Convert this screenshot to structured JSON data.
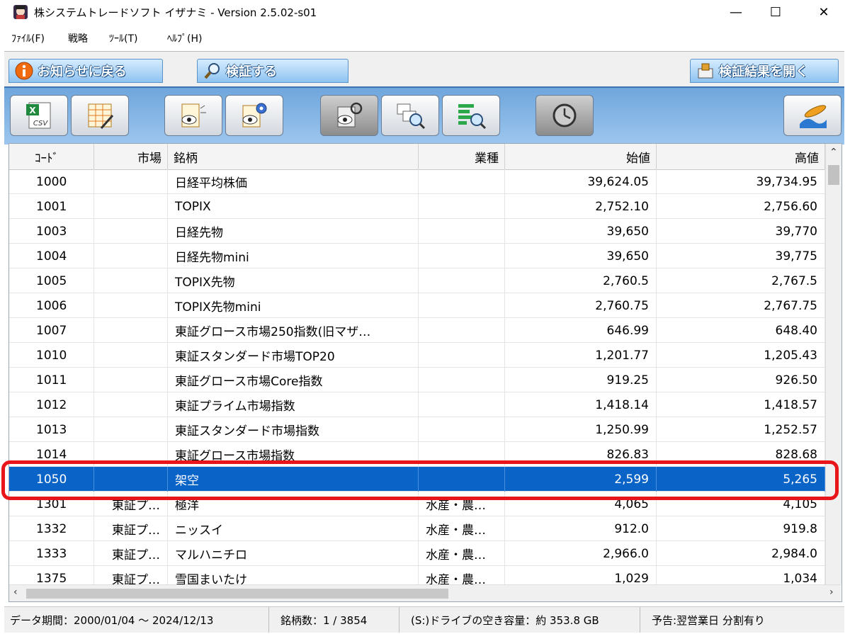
{
  "window": {
    "title": "株システムトレードソフト イザナミ - Version 2.5.02-s01",
    "minimize": "—",
    "maximize": "☐",
    "close": "✕"
  },
  "menu": [
    "ﾌｧｲﾙ(F)",
    "戦略",
    "ﾂｰﾙ(T)",
    "ﾍﾙﾌﾟ(H)"
  ],
  "tabs": {
    "back": "お知らせに戻る",
    "verify": "検証する",
    "open_results": "検証結果を開く"
  },
  "toolbar_icons": [
    "csv-export-icon",
    "table-edit-icon",
    "watch-list-icon",
    "watch-settings-icon",
    "reload-watch-icon",
    "chart-search-icon",
    "ranking-search-icon",
    "timer-icon",
    "surf-icon"
  ],
  "table": {
    "columns": [
      "ｺｰﾄﾞ",
      "市場",
      "銘柄",
      "業種",
      "始値",
      "高値"
    ],
    "rows": [
      {
        "code": "1000",
        "market": "",
        "name": "日経平均株価",
        "industry": "",
        "open": "39,624.05",
        "high": "39,734.95"
      },
      {
        "code": "1001",
        "market": "",
        "name": "TOPIX",
        "industry": "",
        "open": "2,752.10",
        "high": "2,756.60"
      },
      {
        "code": "1003",
        "market": "",
        "name": "日経先物",
        "industry": "",
        "open": "39,650",
        "high": "39,770"
      },
      {
        "code": "1004",
        "market": "",
        "name": "日経先物mini",
        "industry": "",
        "open": "39,650",
        "high": "39,775"
      },
      {
        "code": "1005",
        "market": "",
        "name": "TOPIX先物",
        "industry": "",
        "open": "2,760.5",
        "high": "2,767.5"
      },
      {
        "code": "1006",
        "market": "",
        "name": "TOPIX先物mini",
        "industry": "",
        "open": "2,760.75",
        "high": "2,767.75"
      },
      {
        "code": "1007",
        "market": "",
        "name": "東証グロース市場250指数(旧マザ…",
        "industry": "",
        "open": "646.99",
        "high": "648.40"
      },
      {
        "code": "1010",
        "market": "",
        "name": "東証スタンダード市場TOP20",
        "industry": "",
        "open": "1,201.77",
        "high": "1,205.43"
      },
      {
        "code": "1011",
        "market": "",
        "name": "東証グロース市場Core指数",
        "industry": "",
        "open": "919.25",
        "high": "926.50"
      },
      {
        "code": "1012",
        "market": "",
        "name": "東証プライム市場指数",
        "industry": "",
        "open": "1,418.14",
        "high": "1,418.57"
      },
      {
        "code": "1013",
        "market": "",
        "name": "東証スタンダード市場指数",
        "industry": "",
        "open": "1,250.99",
        "high": "1,252.57"
      },
      {
        "code": "1014",
        "market": "",
        "name": "東証グロース市場指数",
        "industry": "",
        "open": "826.83",
        "high": "828.68"
      },
      {
        "code": "1050",
        "market": "",
        "name": "架空",
        "industry": "",
        "open": "2,599",
        "high": "5,265",
        "selected": true
      },
      {
        "code": "1301",
        "market": "東証プ…",
        "name": "極洋",
        "industry": "水産・農…",
        "open": "4,065",
        "high": "4,105"
      },
      {
        "code": "1332",
        "market": "東証プ…",
        "name": "ニッスイ",
        "industry": "水産・農…",
        "open": "912.0",
        "high": "919.8"
      },
      {
        "code": "1333",
        "market": "東証プ…",
        "name": "マルハニチロ",
        "industry": "水産・農…",
        "open": "2,966.0",
        "high": "2,984.0"
      },
      {
        "code": "1375",
        "market": "東証プ…",
        "name": "雪国まいたけ",
        "industry": "水産・農…",
        "open": "1,029",
        "high": "1,034"
      }
    ]
  },
  "status": {
    "period": "データ期間：2000/01/04 〜 2024/12/13",
    "count": "銘柄数：1 / 3854",
    "drive": "(S:)ドライブの空き容量：約 353.8 GB",
    "forecast": "予告:翌営業日 分割有り"
  },
  "colors": {
    "selection": "#0a64c8",
    "highlight": "#e8151b",
    "toolbar": "#6fa6dc"
  }
}
